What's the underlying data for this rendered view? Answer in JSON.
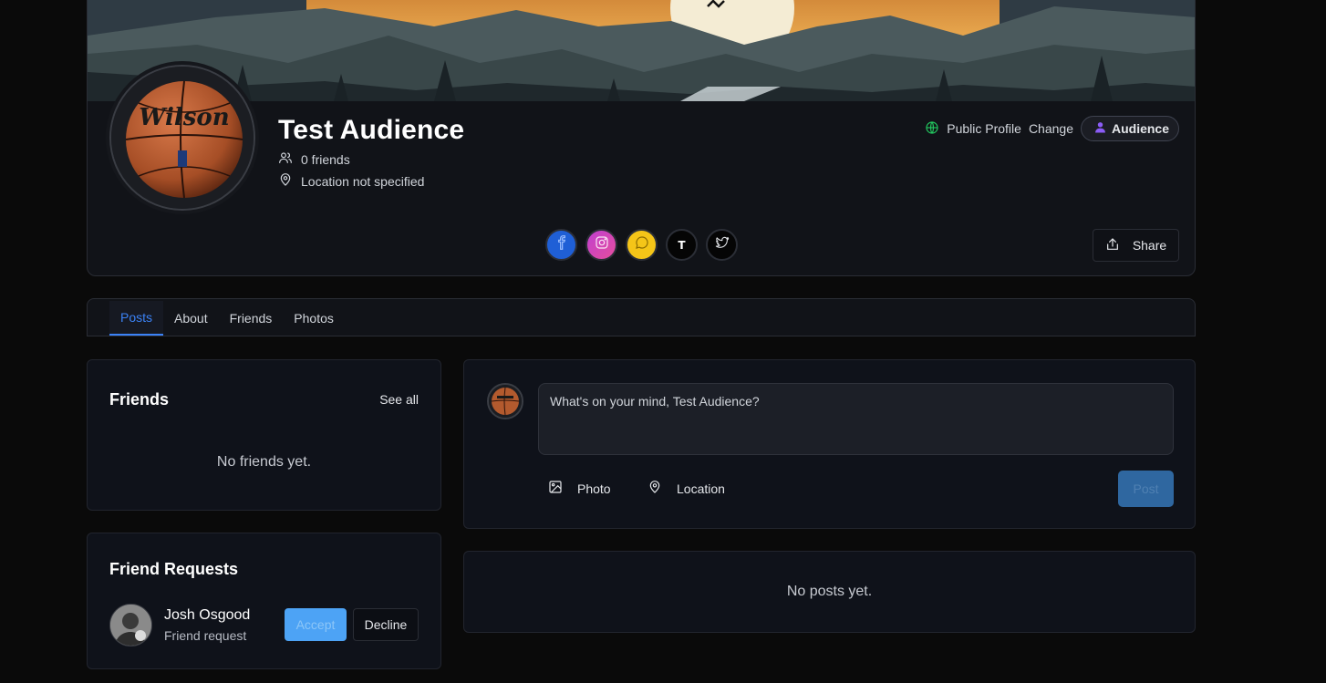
{
  "profile": {
    "name": "Test Audience",
    "friends_count": "0 friends",
    "location": "Location not specified",
    "visibility_label": "Public Profile",
    "change_label": "Change",
    "audience_label": "Audience",
    "share_label": "Share",
    "avatar_brand": "Wilson"
  },
  "socials": [
    {
      "name": "facebook",
      "icon": "facebook-icon",
      "color": "#1f5fd6"
    },
    {
      "name": "instagram",
      "icon": "instagram-icon",
      "color": "#d446b8"
    },
    {
      "name": "snapchat",
      "icon": "chat-icon",
      "color": "#f5c518"
    },
    {
      "name": "threads",
      "icon": "t-icon",
      "glyph": "T",
      "color": "#050505"
    },
    {
      "name": "twitter",
      "icon": "twitter-icon",
      "color": "#050505"
    }
  ],
  "tabs": [
    {
      "label": "Posts",
      "active": true
    },
    {
      "label": "About",
      "active": false
    },
    {
      "label": "Friends",
      "active": false
    },
    {
      "label": "Photos",
      "active": false
    }
  ],
  "friends_panel": {
    "title": "Friends",
    "see_all": "See all",
    "empty": "No friends yet."
  },
  "requests_panel": {
    "title": "Friend Requests",
    "requests": [
      {
        "name": "Josh Osgood",
        "subtitle": "Friend request",
        "accept": "Accept",
        "decline": "Decline"
      }
    ]
  },
  "composer": {
    "placeholder": "What's on your mind, Test Audience?",
    "photo_label": "Photo",
    "location_label": "Location",
    "post_label": "Post"
  },
  "posts": {
    "empty": "No posts yet."
  },
  "colors": {
    "accent": "#3b82f6",
    "accept": "#4da3f5",
    "post": "#2f67a0",
    "visibility_globe": "#22c55e",
    "audience_icon": "#8b5cf6"
  }
}
